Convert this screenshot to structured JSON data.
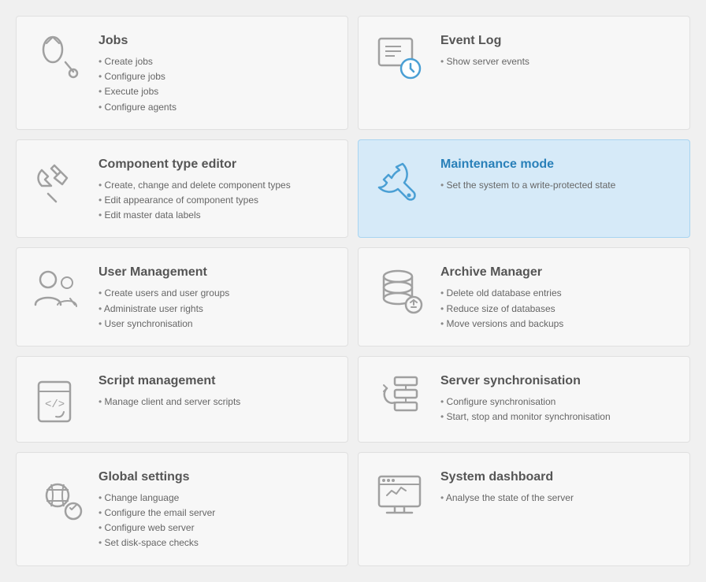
{
  "cards": [
    {
      "id": "jobs",
      "title": "Jobs",
      "active": false,
      "icon": "jobs",
      "items": [
        "Create jobs",
        "Configure jobs",
        "Execute jobs",
        "Configure agents"
      ]
    },
    {
      "id": "event-log",
      "title": "Event Log",
      "active": false,
      "icon": "event-log",
      "items": [
        "Show server events"
      ]
    },
    {
      "id": "component-type-editor",
      "title": "Component type editor",
      "active": false,
      "icon": "component-type-editor",
      "items": [
        "Create, change and delete component types",
        "Edit appearance of component types",
        "Edit master data labels"
      ]
    },
    {
      "id": "maintenance-mode",
      "title": "Maintenance mode",
      "active": true,
      "icon": "maintenance-mode",
      "items": [
        "Set the system to a write-protected state"
      ]
    },
    {
      "id": "user-management",
      "title": "User Management",
      "active": false,
      "icon": "user-management",
      "items": [
        "Create users and user groups",
        "Administrate user rights",
        "User synchronisation"
      ]
    },
    {
      "id": "archive-manager",
      "title": "Archive Manager",
      "active": false,
      "icon": "archive-manager",
      "items": [
        "Delete old database entries",
        "Reduce size of databases",
        "Move versions and backups"
      ]
    },
    {
      "id": "script-management",
      "title": "Script management",
      "active": false,
      "icon": "script-management",
      "items": [
        "Manage client and server scripts"
      ]
    },
    {
      "id": "server-synchronisation",
      "title": "Server synchronisation",
      "active": false,
      "icon": "server-synchronisation",
      "items": [
        "Configure synchronisation",
        "Start, stop and monitor synchronisation"
      ]
    },
    {
      "id": "global-settings",
      "title": "Global settings",
      "active": false,
      "icon": "global-settings",
      "items": [
        "Change language",
        "Configure the email server",
        "Configure web server",
        "Set disk-space checks"
      ]
    },
    {
      "id": "system-dashboard",
      "title": "System dashboard",
      "active": false,
      "icon": "system-dashboard",
      "items": [
        "Analyse the state of the server"
      ]
    }
  ]
}
